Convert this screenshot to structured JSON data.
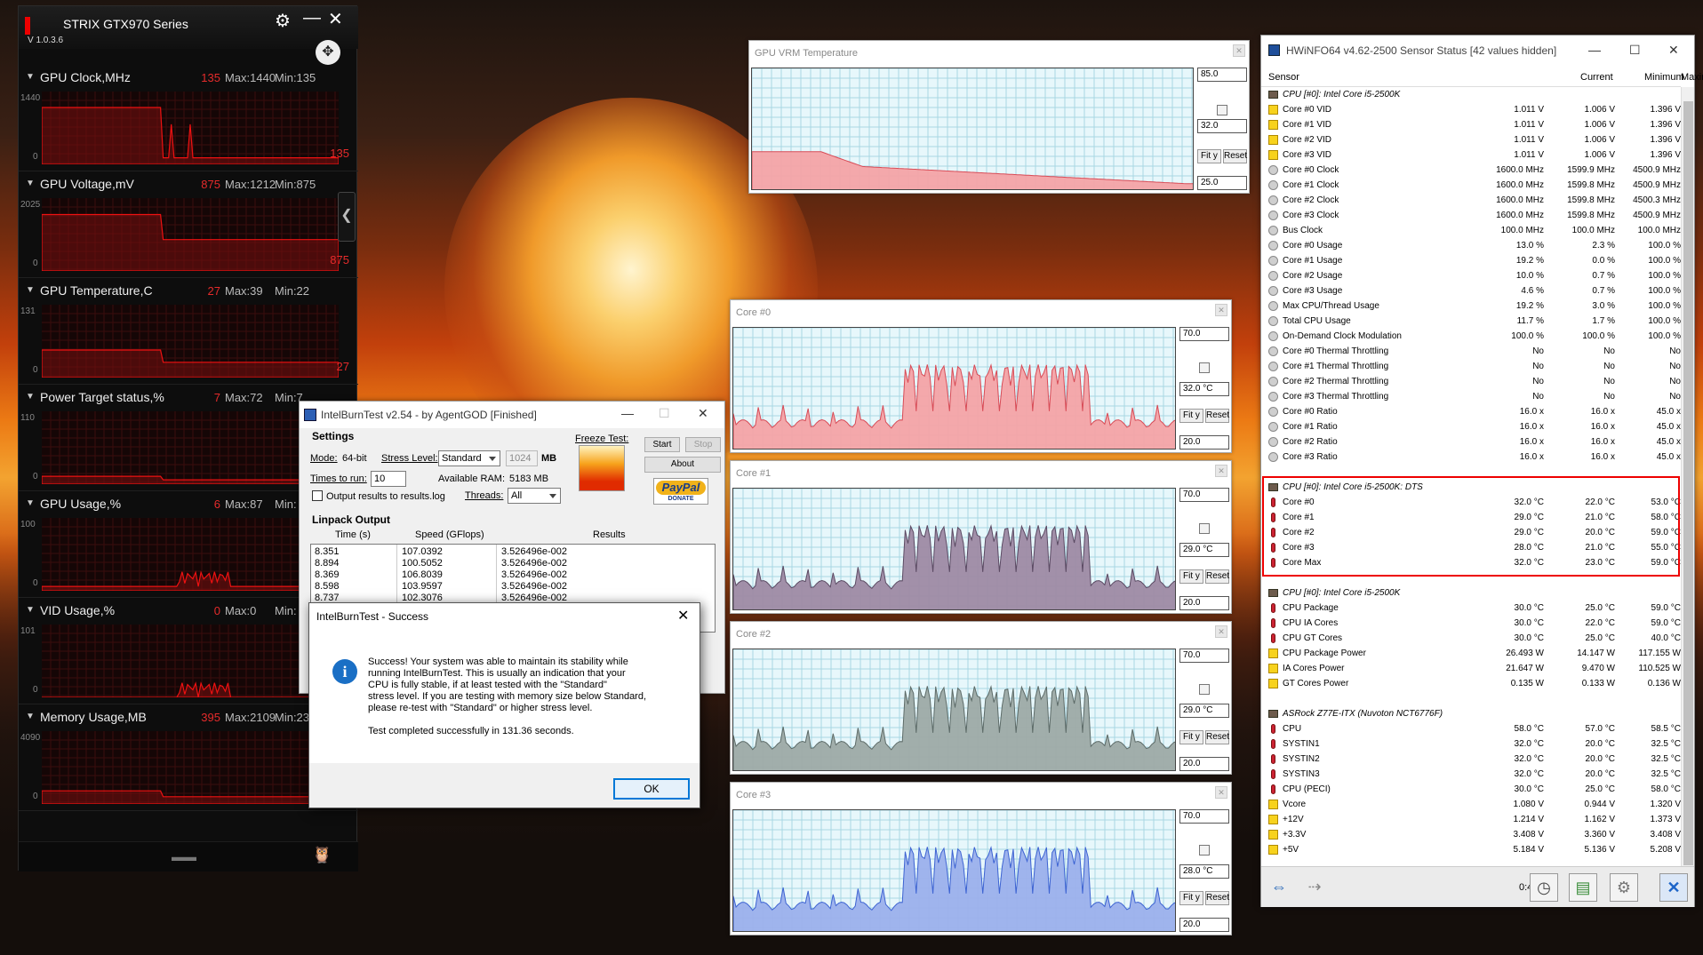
{
  "gpu_tweak": {
    "title": "STRIX GTX970 Series",
    "version": "V 1.0.3.6",
    "panels": [
      {
        "name": "GPU Clock,MHz",
        "current": "135",
        "max": "Max:1440",
        "min": "Min:135",
        "top": "1440",
        "zero": "0",
        "right": "135",
        "level": 0.09
      },
      {
        "name": "GPU Voltage,mV",
        "current": "875",
        "max": "Max:1212",
        "min": "Min:875",
        "top": "2025",
        "zero": "0",
        "right": "875",
        "level": 0.43
      },
      {
        "name": "GPU Temperature,C",
        "current": "27",
        "max": "Max:39",
        "min": "Min:22",
        "top": "131",
        "zero": "0",
        "right": "27",
        "level": 0.21
      },
      {
        "name": "Power Target status,%",
        "current": "7",
        "max": "Max:72",
        "min": "Min:7",
        "top": "110",
        "zero": "0",
        "right": "",
        "level": 0.06
      },
      {
        "name": "GPU Usage,%",
        "current": "6",
        "max": "Max:87",
        "min": "Min:",
        "top": "100",
        "zero": "0",
        "right": "",
        "level": 0.06
      },
      {
        "name": "VID Usage,%",
        "current": "0",
        "max": "Max:0",
        "min": "Min:",
        "top": "101",
        "zero": "0",
        "right": "",
        "level": 0.0
      },
      {
        "name": "Memory Usage,MB",
        "current": "395",
        "max": "Max:2109",
        "min": "Min:23",
        "top": "4090",
        "zero": "0",
        "right": "",
        "level": 0.1
      }
    ]
  },
  "ibt": {
    "title": "IntelBurnTest v2.54 - by AgentGOD [Finished]",
    "settings": "Settings",
    "mode_label": "Mode:",
    "mode_value": "64-bit",
    "stress_label": "Stress Level:",
    "stress_value": "Standard",
    "mem_value": "1024",
    "mem_unit": "MB",
    "times_label": "Times to run:",
    "times_value": "10",
    "ram_label": "Available RAM:",
    "ram_value": "5183 MB",
    "threads_label": "Threads:",
    "threads_value": "All",
    "freeze_label": "Freeze Test:",
    "start": "Start",
    "stop": "Stop",
    "about": "About",
    "paypal": "PayPal",
    "donate": "DONATE",
    "output_log": "Output results to results.log",
    "linpack": "Linpack Output",
    "col_time": "Time (s)",
    "col_speed": "Speed (GFlops)",
    "col_results": "Results",
    "rows": [
      [
        "8.351",
        "107.0392",
        "3.526496e-002"
      ],
      [
        "8.894",
        "100.5052",
        "3.526496e-002"
      ],
      [
        "8.369",
        "106.8039",
        "3.526496e-002"
      ],
      [
        "8.598",
        "103.9597",
        "3.526496e-002"
      ],
      [
        "8.737",
        "102.3076",
        "3.526496e-002"
      ]
    ]
  },
  "dialog": {
    "title": "IntelBurnTest - Success",
    "lines": [
      "Success! Your system was able to maintain its stability while",
      "running IntelBurnTest. This is usually an indication that your",
      "CPU is fully stable, if at least tested with the \"Standard\"",
      "stress level. If you are testing with memory size below Standard,",
      "please re-test with \"Standard\" or higher stress level."
    ],
    "completed": "Test completed successfully in 131.36 seconds.",
    "ok": "OK"
  },
  "graphs": [
    {
      "title": "GPU VRM Temperature",
      "max": "85.0",
      "current": "32.0",
      "min": "25.0",
      "fit": "Fit y",
      "reset": "Reset",
      "color": "#f4a3a7",
      "stroke": "#d84b56"
    },
    {
      "title": "Core #0",
      "max": "70.0",
      "current": "32.0 °C",
      "min": "20.0",
      "fit": "Fit y",
      "reset": "Reset",
      "color": "#f4a3a7",
      "stroke": "#d84b56"
    },
    {
      "title": "Core #1",
      "max": "70.0",
      "current": "29.0 °C",
      "min": "20.0",
      "fit": "Fit y",
      "reset": "Reset",
      "color": "#9e8aa4",
      "stroke": "#5b4a63"
    },
    {
      "title": "Core #2",
      "max": "70.0",
      "current": "29.0 °C",
      "min": "20.0",
      "fit": "Fit y",
      "reset": "Reset",
      "color": "#9daaa6",
      "stroke": "#5d6b68"
    },
    {
      "title": "Core #3",
      "max": "70.0",
      "current": "28.0 °C",
      "min": "20.0",
      "fit": "Fit y",
      "reset": "Reset",
      "color": "#9bb0ec",
      "stroke": "#3d63d2"
    }
  ],
  "hwinfo": {
    "title": "HWiNFO64 v4.62-2500 Sensor Status [42 values hidden]",
    "columns": [
      "Sensor",
      "Current",
      "Minimum",
      "Maximum"
    ],
    "elapsed": "0:42:30",
    "rows": [
      {
        "t": "grp",
        "name": "CPU [#0]: Intel Core i5-2500K"
      },
      {
        "t": "b",
        "name": "Core #0 VID",
        "cur": "1.011 V",
        "min": "1.006 V",
        "max": "1.396 V"
      },
      {
        "t": "b",
        "name": "Core #1 VID",
        "cur": "1.011 V",
        "min": "1.006 V",
        "max": "1.396 V"
      },
      {
        "t": "b",
        "name": "Core #2 VID",
        "cur": "1.011 V",
        "min": "1.006 V",
        "max": "1.396 V"
      },
      {
        "t": "b",
        "name": "Core #3 VID",
        "cur": "1.011 V",
        "min": "1.006 V",
        "max": "1.396 V"
      },
      {
        "t": "g",
        "name": "Core #0 Clock",
        "cur": "1600.0 MHz",
        "min": "1599.9 MHz",
        "max": "4500.9 MHz"
      },
      {
        "t": "g",
        "name": "Core #1 Clock",
        "cur": "1600.0 MHz",
        "min": "1599.8 MHz",
        "max": "4500.9 MHz"
      },
      {
        "t": "g",
        "name": "Core #2 Clock",
        "cur": "1600.0 MHz",
        "min": "1599.8 MHz",
        "max": "4500.3 MHz"
      },
      {
        "t": "g",
        "name": "Core #3 Clock",
        "cur": "1600.0 MHz",
        "min": "1599.8 MHz",
        "max": "4500.9 MHz"
      },
      {
        "t": "g",
        "name": "Bus Clock",
        "cur": "100.0 MHz",
        "min": "100.0 MHz",
        "max": "100.0 MHz"
      },
      {
        "t": "g",
        "name": "Core #0 Usage",
        "cur": "13.0 %",
        "min": "2.3 %",
        "max": "100.0 %"
      },
      {
        "t": "g",
        "name": "Core #1 Usage",
        "cur": "19.2 %",
        "min": "0.0 %",
        "max": "100.0 %"
      },
      {
        "t": "g",
        "name": "Core #2 Usage",
        "cur": "10.0 %",
        "min": "0.7 %",
        "max": "100.0 %"
      },
      {
        "t": "g",
        "name": "Core #3 Usage",
        "cur": "4.6 %",
        "min": "0.7 %",
        "max": "100.0 %"
      },
      {
        "t": "g",
        "name": "Max CPU/Thread Usage",
        "cur": "19.2 %",
        "min": "3.0 %",
        "max": "100.0 %"
      },
      {
        "t": "g",
        "name": "Total CPU Usage",
        "cur": "11.7 %",
        "min": "1.7 %",
        "max": "100.0 %"
      },
      {
        "t": "g",
        "name": "On-Demand Clock Modulation",
        "cur": "100.0 %",
        "min": "100.0 %",
        "max": "100.0 %"
      },
      {
        "t": "g",
        "name": "Core #0 Thermal Throttling",
        "cur": "No",
        "min": "No",
        "max": "No"
      },
      {
        "t": "g",
        "name": "Core #1 Thermal Throttling",
        "cur": "No",
        "min": "No",
        "max": "No"
      },
      {
        "t": "g",
        "name": "Core #2 Thermal Throttling",
        "cur": "No",
        "min": "No",
        "max": "No"
      },
      {
        "t": "g",
        "name": "Core #3 Thermal Throttling",
        "cur": "No",
        "min": "No",
        "max": "No"
      },
      {
        "t": "g",
        "name": "Core #0 Ratio",
        "cur": "16.0 x",
        "min": "16.0 x",
        "max": "45.0 x"
      },
      {
        "t": "g",
        "name": "Core #1 Ratio",
        "cur": "16.0 x",
        "min": "16.0 x",
        "max": "45.0 x"
      },
      {
        "t": "g",
        "name": "Core #2 Ratio",
        "cur": "16.0 x",
        "min": "16.0 x",
        "max": "45.0 x"
      },
      {
        "t": "g",
        "name": "Core #3 Ratio",
        "cur": "16.0 x",
        "min": "16.0 x",
        "max": "45.0 x"
      },
      {
        "t": "sp",
        "name": ""
      },
      {
        "t": "grp",
        "name": "CPU [#0]: Intel Core i5-2500K: DTS"
      },
      {
        "t": "t",
        "name": "Core #0",
        "cur": "32.0 °C",
        "min": "22.0 °C",
        "max": "53.0 °C"
      },
      {
        "t": "t",
        "name": "Core #1",
        "cur": "29.0 °C",
        "min": "21.0 °C",
        "max": "58.0 °C"
      },
      {
        "t": "t",
        "name": "Core #2",
        "cur": "29.0 °C",
        "min": "20.0 °C",
        "max": "59.0 °C"
      },
      {
        "t": "t",
        "name": "Core #3",
        "cur": "28.0 °C",
        "min": "21.0 °C",
        "max": "55.0 °C"
      },
      {
        "t": "t",
        "name": "Core Max",
        "cur": "32.0 °C",
        "min": "23.0 °C",
        "max": "59.0 °C"
      },
      {
        "t": "sp",
        "name": ""
      },
      {
        "t": "grp",
        "name": "CPU [#0]: Intel Core i5-2500K"
      },
      {
        "t": "t",
        "name": "CPU Package",
        "cur": "30.0 °C",
        "min": "25.0 °C",
        "max": "59.0 °C"
      },
      {
        "t": "t",
        "name": "CPU IA Cores",
        "cur": "30.0 °C",
        "min": "22.0 °C",
        "max": "59.0 °C"
      },
      {
        "t": "t",
        "name": "CPU GT Cores",
        "cur": "30.0 °C",
        "min": "25.0 °C",
        "max": "40.0 °C"
      },
      {
        "t": "b",
        "name": "CPU Package Power",
        "cur": "26.493 W",
        "min": "14.147 W",
        "max": "117.155 W"
      },
      {
        "t": "b",
        "name": "IA Cores Power",
        "cur": "21.647 W",
        "min": "9.470 W",
        "max": "110.525 W"
      },
      {
        "t": "b",
        "name": "GT Cores Power",
        "cur": "0.135 W",
        "min": "0.133 W",
        "max": "0.136 W"
      },
      {
        "t": "sp",
        "name": ""
      },
      {
        "t": "grp",
        "name": "ASRock Z77E-ITX (Nuvoton NCT6776F)"
      },
      {
        "t": "t",
        "name": "CPU",
        "cur": "58.0 °C",
        "min": "57.0 °C",
        "max": "58.5 °C"
      },
      {
        "t": "t",
        "name": "SYSTIN1",
        "cur": "32.0 °C",
        "min": "20.0 °C",
        "max": "32.5 °C"
      },
      {
        "t": "t",
        "name": "SYSTIN2",
        "cur": "32.0 °C",
        "min": "20.0 °C",
        "max": "32.5 °C"
      },
      {
        "t": "t",
        "name": "SYSTIN3",
        "cur": "32.0 °C",
        "min": "20.0 °C",
        "max": "32.5 °C"
      },
      {
        "t": "t",
        "name": "CPU (PECI)",
        "cur": "30.0 °C",
        "min": "25.0 °C",
        "max": "58.0 °C"
      },
      {
        "t": "b",
        "name": "Vcore",
        "cur": "1.080 V",
        "min": "0.944 V",
        "max": "1.320 V"
      },
      {
        "t": "b",
        "name": "+12V",
        "cur": "1.214 V",
        "min": "1.162 V",
        "max": "1.373 V"
      },
      {
        "t": "b",
        "name": "+3.3V",
        "cur": "3.408 V",
        "min": "3.360 V",
        "max": "3.408 V"
      },
      {
        "t": "b",
        "name": "+5V",
        "cur": "5.184 V",
        "min": "5.136 V",
        "max": "5.208 V"
      }
    ]
  }
}
